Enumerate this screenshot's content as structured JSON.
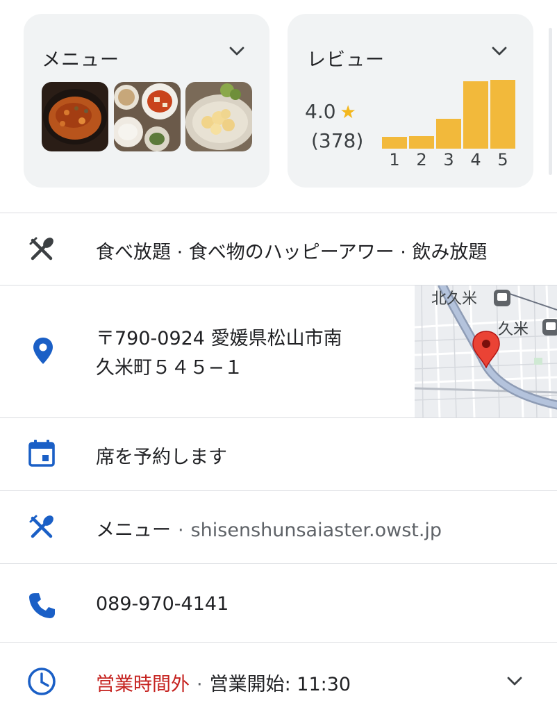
{
  "menu_card": {
    "title": "メニュー",
    "photos": [
      "mapo-tofu-photo",
      "set-meal-photo",
      "fried-chicken-photo"
    ]
  },
  "review_card": {
    "title": "レビュー",
    "rating": "4.0",
    "count": "(378)",
    "distribution": [
      {
        "label": "1",
        "value": 0.1
      },
      {
        "label": "2",
        "value": 0.11
      },
      {
        "label": "3",
        "value": 0.26
      },
      {
        "label": "4",
        "value": 0.59
      },
      {
        "label": "5",
        "value": 0.6
      }
    ],
    "bar_color": "#f2b93b"
  },
  "rows": {
    "tags": {
      "text": "食べ放題 · 食べ物のハッピーアワー · 飲み放題",
      "icon": "restaurant-icon"
    },
    "address": {
      "line1": "〒790-0924 愛媛県松山市南",
      "line2": "久米町５４５−１",
      "icon": "location-pin-icon",
      "map_labels": [
        "北久米",
        "久米"
      ]
    },
    "reserve": {
      "text": "席を予約します",
      "icon": "calendar-icon"
    },
    "menu": {
      "label": "メニュー",
      "separator": "·",
      "url": "shisenshunsaiaster.owst.jp",
      "icon": "restaurant-icon"
    },
    "phone": {
      "number": "089-970-4141",
      "icon": "phone-icon"
    },
    "hours": {
      "status": "営業時間外",
      "separator": "·",
      "opens": "営業開始: 11:30",
      "icon": "clock-icon"
    }
  },
  "colors": {
    "accent": "#1a5fc6",
    "closed": "#c5221f",
    "card_bg": "#f1f3f4",
    "star": "#f3b71e"
  }
}
